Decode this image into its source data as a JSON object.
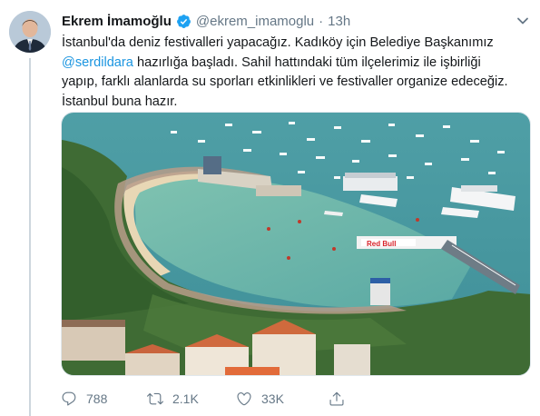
{
  "tweet": {
    "author_name": "Ekrem İmamoğlu",
    "handle": "@ekrem_imamoglu",
    "separator": "·",
    "timestamp": "13h",
    "text_line1": "İstanbul'da deniz festivalleri yapacağız. Kadıköy için Belediye Başkanımız",
    "mention": "@serdildara",
    "text_line2_rest": " hazırlığa başladı. Sahil hattındaki tüm ilçelerimiz ile işbirliği",
    "text_line3": "yapıp, farklı alanlarda su sporları etkinlikleri ve festivaller organize edeceğiz.",
    "text_line4": "İstanbul buna hazır.",
    "banner_text": "Red Bull"
  },
  "actions": {
    "reply_count": "788",
    "retweet_count": "2.1K",
    "like_count": "33K"
  },
  "icons": {
    "verified": "verified-badge-icon",
    "caret": "chevron-down-icon",
    "reply": "reply-icon",
    "retweet": "retweet-icon",
    "like": "heart-icon",
    "share": "share-icon"
  },
  "colors": {
    "accent": "#1da1f2",
    "link": "#1b95e0",
    "secondary_text": "#657786",
    "banner_red": "#d8232a"
  }
}
